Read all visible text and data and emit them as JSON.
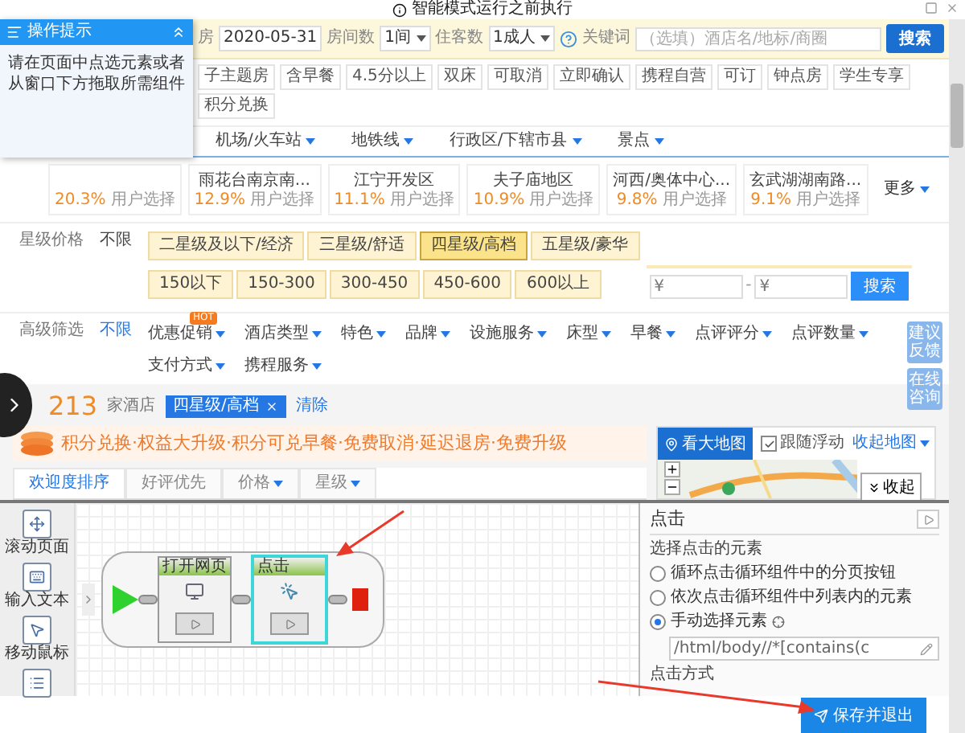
{
  "window": {
    "title": "智能模式运行之前执行"
  },
  "tip_panel": {
    "title": "操作提示",
    "expanded": true,
    "body": "请在页面中点选元素或者从窗口下方拖取所需组件"
  },
  "search_bar": {
    "checkout_label": "房",
    "checkout_date": "2020-05-31",
    "rooms_label": "房间数",
    "rooms": "1间",
    "guests_label": "住客数",
    "guests": "1成人",
    "keyword_label": "关键词",
    "keyword_placeholder": "（选填）酒店名/地标/商圈",
    "search_button": "搜索"
  },
  "quick_tags": [
    "子主题房",
    "含早餐",
    "4.5分以上",
    "双床",
    "可取消",
    "立即确认",
    "携程自营",
    "可订",
    "钟点房",
    "学生专享",
    "积分兑换"
  ],
  "location_tabs": [
    "机场/火车站",
    "地铁线",
    "行政区/下辖市县",
    "景点"
  ],
  "areas": [
    {
      "share": "20.3%",
      "note": "用户选择"
    },
    {
      "name": "雨花台南京南...",
      "share": "12.9%",
      "note": "用户选择"
    },
    {
      "name": "江宁开发区",
      "share": "11.1%",
      "note": "用户选择"
    },
    {
      "name": "夫子庙地区",
      "share": "10.9%",
      "note": "用户选择"
    },
    {
      "name": "河西/奥体中心...",
      "share": "9.8%",
      "note": "用户选择"
    },
    {
      "name": "玄武湖湖南路...",
      "share": "9.1%",
      "note": "用户选择"
    }
  ],
  "areas_more": "更多",
  "star_price": {
    "label": "星级价格",
    "any": "不限",
    "stars": [
      {
        "label": "二星级及以下/经济",
        "selected": false
      },
      {
        "label": "三星级/舒适",
        "selected": false
      },
      {
        "label": "四星级/高档",
        "selected": true
      },
      {
        "label": "五星级/豪华",
        "selected": false
      }
    ],
    "prices": [
      {
        "label": "150以下",
        "selected": false
      },
      {
        "label": "150-300",
        "selected": false
      },
      {
        "label": "300-450",
        "selected": false
      },
      {
        "label": "450-600",
        "selected": false
      },
      {
        "label": "600以上",
        "selected": false
      }
    ],
    "min_placeholder": "¥",
    "separator": "-",
    "max_placeholder": "¥",
    "search_button": "搜索"
  },
  "advanced": {
    "label": "高级筛选",
    "any": "不限",
    "filters": [
      {
        "label": "优惠促销",
        "badge": "HOT"
      },
      {
        "label": "酒店类型"
      },
      {
        "label": "特色"
      },
      {
        "label": "品牌"
      },
      {
        "label": "设施服务"
      },
      {
        "label": "床型"
      },
      {
        "label": "早餐"
      },
      {
        "label": "点评评分"
      },
      {
        "label": "点评数量"
      },
      {
        "label": "支付方式"
      },
      {
        "label": "携程服务"
      }
    ]
  },
  "side_buttons": [
    "建议反馈",
    "在线咨询"
  ],
  "results": {
    "count": "213",
    "unit": "家酒店",
    "chips": [
      "四星级/高档"
    ],
    "clear": "清除"
  },
  "banner": {
    "text": "积分兑换·权益大升级·积分可兑早餐·免费取消·延迟退房·免费升级"
  },
  "sort_tabs": [
    {
      "label": "欢迎度排序",
      "selected": true,
      "dropdown": false
    },
    {
      "label": "好评优先",
      "selected": false,
      "dropdown": false
    },
    {
      "label": "价格",
      "selected": false,
      "dropdown": true
    },
    {
      "label": "星级",
      "selected": false,
      "dropdown": true
    }
  ],
  "map": {
    "button": "看大地图",
    "follow_label": "跟随浮动",
    "follow": true,
    "collapse": "收起地图"
  },
  "editor": {
    "collapse": "收起",
    "tools": [
      {
        "kind": "scroll",
        "label": "滚动页面"
      },
      {
        "kind": "type",
        "label": "输入文本"
      },
      {
        "kind": "mouse",
        "label": "移动鼠标"
      },
      {
        "kind": "more"
      }
    ],
    "flow": [
      {
        "kind": "start"
      },
      {
        "kind": "open",
        "title": "打开网页",
        "selected": false
      },
      {
        "kind": "click",
        "title": "点击",
        "selected": true
      },
      {
        "kind": "end"
      }
    ]
  },
  "properties": {
    "title": "点击",
    "section": "选择点击的元素",
    "options": [
      {
        "label": "循环点击循环组件中的分页按钮",
        "selected": false
      },
      {
        "label": "依次点击循环组件中列表内的元素",
        "selected": false
      },
      {
        "label": "手动选择元素",
        "selected": true
      }
    ],
    "xpath": "/html/body//*[contains(c",
    "next_section": "点击方式"
  },
  "footer": {
    "save_button": "保存并退出"
  }
}
